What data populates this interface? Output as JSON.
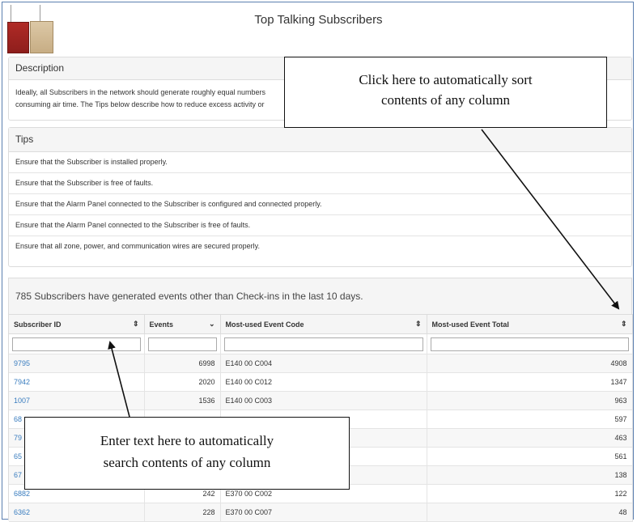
{
  "header": {
    "title": "Top Talking Subscribers"
  },
  "description": {
    "heading": "Description",
    "line1": "Ideally, all Subscribers in the network should generate roughly equal numbers",
    "line2": "consuming air time. The Tips below describe how to reduce excess activity or"
  },
  "tips": {
    "heading": "Tips",
    "items": [
      "Ensure that the Subscriber is installed properly.",
      "Ensure that the Subscriber is free of faults.",
      "Ensure that the Alarm Panel connected to the Subscriber is configured and connected properly.",
      "Ensure that the Alarm Panel connected to the Subscriber is free of faults.",
      "Ensure that all zone, power, and communication wires are secured properly."
    ]
  },
  "table": {
    "summary": "785 Subscribers have generated events other than Check-ins in the last 10 days.",
    "columns": [
      "Subscriber ID",
      "Events",
      "Most-used Event Code",
      "Most-used Event Total"
    ],
    "rows": [
      [
        "9795",
        "6998",
        "E140 00 C004",
        "4908"
      ],
      [
        "7942",
        "2020",
        "E140 00 C012",
        "1347"
      ],
      [
        "1007",
        "1536",
        "E140 00 C003",
        "963"
      ],
      [
        "68",
        "",
        "",
        "597"
      ],
      [
        "79",
        "",
        "",
        "463"
      ],
      [
        "65",
        "",
        "",
        "561"
      ],
      [
        "67",
        "",
        "",
        "138"
      ],
      [
        "6882",
        "242",
        "E370 00 C002",
        "122"
      ],
      [
        "6362",
        "228",
        "E370 00 C007",
        "48"
      ]
    ]
  },
  "annotations": {
    "sort_line1": "Click here to automatically sort",
    "sort_line2": "contents of any column",
    "search_line1": "Enter text here to automatically",
    "search_line2": "search contents of any column"
  },
  "colors": {
    "link": "#3a7dbf",
    "border": "#dcdcdc",
    "frame": "#5b7fb0"
  }
}
